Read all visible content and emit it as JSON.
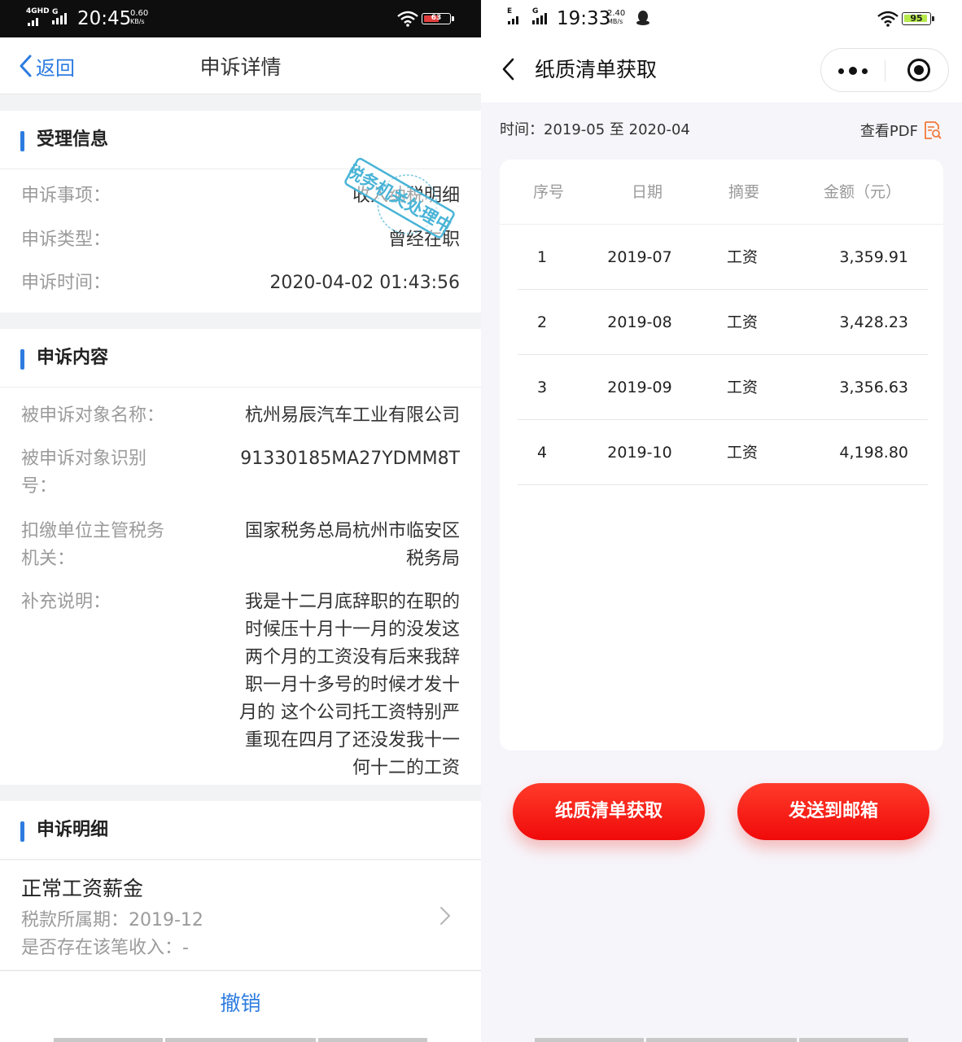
{
  "left": {
    "status": {
      "network": "4GHD",
      "network2": "G",
      "time": "20:45",
      "speed_value": "0.60",
      "speed_unit": "KB/s",
      "battery": "63",
      "battery_level": 0.63,
      "battery_color": "#e23d3d"
    },
    "nav": {
      "back_label": "返回",
      "title": "申诉详情"
    },
    "accept_info": {
      "title": "受理信息",
      "rows": [
        {
          "key": "申诉事项：",
          "value": "收入纳税明细"
        },
        {
          "key": "申诉类型：",
          "value": "曾经在职"
        },
        {
          "key": "申诉时间：",
          "value": "2020-04-02 01:43:56"
        }
      ]
    },
    "stamp": {
      "text": "税务机关处理中",
      "color": "#49b4d6"
    },
    "appeal_content": {
      "title": "申诉内容",
      "target_name": {
        "key": "被申诉对象名称：",
        "value": "杭州易辰汽车工业有限公司"
      },
      "target_id": {
        "key_line1": "被申诉对象识别",
        "key_line2": "号：",
        "value": "91330185MA27YDMM8T"
      },
      "authority": {
        "key_line1": "扣缴单位主管税务",
        "key_line2": "机关：",
        "value_line1": "国家税务总局杭州市临安区",
        "value_line2": "税务局"
      },
      "remark": {
        "key": "补充说明：",
        "lines": [
          "我是十二月底辞职的在职的",
          "时候压十月十一月的没发这",
          "两个月的工资没有后来我辞",
          "职一月十多号的时候才发十",
          "月的 这个公司托工资特别严",
          "重现在四月了还没发我十一",
          "何十二的工资"
        ]
      }
    },
    "appeal_detail": {
      "title": "申诉明细",
      "item": {
        "name": "正常工资薪金",
        "period": "税款所属期：2019-12",
        "exists": "是否存在该笔收入：-"
      }
    },
    "bottom": {
      "revoke_label": "撤销"
    },
    "colors": {
      "accent": "#2d7ce0"
    }
  },
  "right": {
    "status": {
      "network": "E",
      "network2": "G",
      "time": "19:33",
      "speed_value": "2.40",
      "speed_unit": "MB/s",
      "notify_icon": "qq-penguin-icon",
      "battery": "95",
      "battery_level": 0.95,
      "battery_color": "#b6ea4a"
    },
    "nav": {
      "title": "纸质清单获取"
    },
    "period": "时间：2019-05 至 2020-04",
    "pdf_label": "查看PDF",
    "table": {
      "headers": [
        "序号",
        "日期",
        "摘要",
        "金额（元）"
      ],
      "rows": [
        [
          "1",
          "2019-07",
          "工资",
          "3,359.91"
        ],
        [
          "2",
          "2019-08",
          "工资",
          "3,428.23"
        ],
        [
          "3",
          "2019-09",
          "工资",
          "3,356.63"
        ],
        [
          "4",
          "2019-10",
          "工资",
          "4,198.80"
        ]
      ]
    },
    "buttons": {
      "get_paper": "纸质清单获取",
      "send_email": "发送到邮箱"
    },
    "colors": {
      "primary_red": "#f00a0a",
      "pdf_icon": "#f07a3a"
    }
  }
}
